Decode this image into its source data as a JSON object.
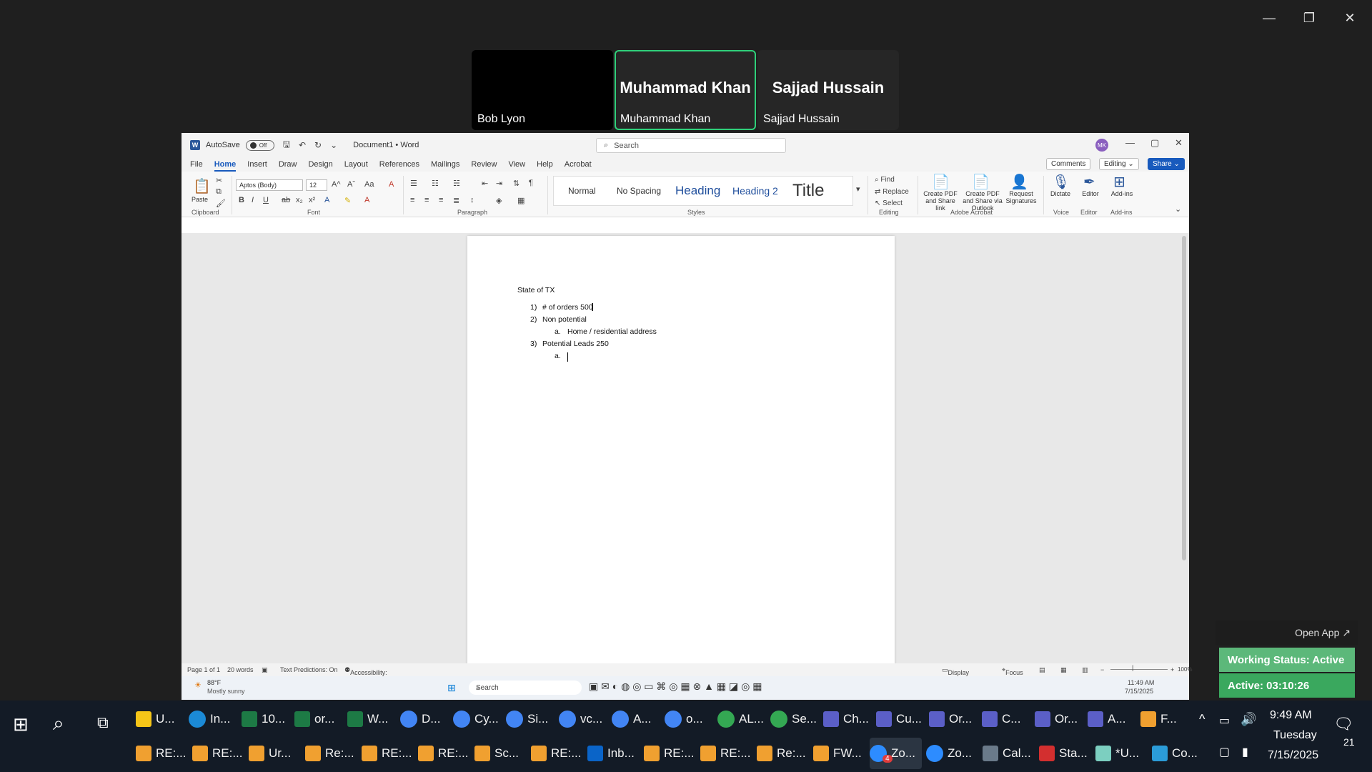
{
  "outer_window": {
    "minimize": "—",
    "restore": "❐",
    "close": "✕"
  },
  "participants": [
    {
      "name": "Bob Lyon",
      "display": "",
      "video_off_black": true
    },
    {
      "name": "Muhammad Khan",
      "display": "Muhammad Khan",
      "active_speaker": true
    },
    {
      "name": "Sajjad Hussain",
      "display": "Sajjad Hussain"
    }
  ],
  "word": {
    "autosave_label": "AutoSave",
    "autosave_state": "Off",
    "doc_title": "Document1 • Word",
    "search_placeholder": "Search",
    "avatar_initials": "MK",
    "menu": [
      "File",
      "Home",
      "Insert",
      "Draw",
      "Design",
      "Layout",
      "References",
      "Mailings",
      "Review",
      "View",
      "Help",
      "Acrobat"
    ],
    "menu_selected": "Home",
    "comments_label": "Comments",
    "editing_label": "Editing",
    "share_label": "Share",
    "font_name": "Aptos (Body)",
    "font_size": "12",
    "groups": {
      "clipboard": "Clipboard",
      "font": "Font",
      "paragraph": "Paragraph",
      "styles": "Styles",
      "editing": "Editing",
      "adobe": "Adobe Acrobat",
      "voice": "Voice",
      "editor": "Editor",
      "addins": "Add-ins"
    },
    "paste_label": "Paste",
    "styles": [
      "Normal",
      "No Spacing",
      "Heading",
      "Heading 2",
      "Title"
    ],
    "find_label": "Find",
    "replace_label": "Replace",
    "select_label": "Select",
    "create_pdf_link": "Create PDF and Share link",
    "create_pdf_outlook": "Create PDF and Share via Outlook",
    "request_signatures": "Request Signatures",
    "dictate_label": "Dictate",
    "editor_label": "Editor",
    "addins_label": "Add-ins",
    "document": {
      "heading": "State of TX",
      "items": [
        {
          "marker": "1)",
          "text": "# of orders 500"
        },
        {
          "marker": "2)",
          "text": "Non potential"
        },
        {
          "marker": "a.",
          "text": "Home / residential address"
        },
        {
          "marker": "3)",
          "text": "Potential Leads 250"
        },
        {
          "marker": "a.",
          "text": ""
        }
      ]
    },
    "status": {
      "page": "Page 1 of 1",
      "words": "20 words",
      "predictions": "Text Predictions: On",
      "accessibility": "Accessibility: Good to go",
      "display_settings": "Display Settings",
      "focus": "Focus",
      "zoom": "100%"
    }
  },
  "inner_taskbar": {
    "weather_temp": "88°F",
    "weather_desc": "Mostly sunny",
    "search": "Search",
    "time": "11:49 AM",
    "date": "7/15/2025"
  },
  "zoom_overlay": {
    "open_app": "Open App ↗",
    "working_status": "Working Status: Active",
    "active_timer": "Active: 03:10:26",
    "colors": {
      "working": "#5cb87a",
      "active": "#3aa85e"
    }
  },
  "taskbar": {
    "row1": [
      {
        "label": "U...",
        "color": "#f5c518",
        "shape": "sq"
      },
      {
        "label": "In...",
        "color": "#1b8ad6",
        "shape": "ico"
      },
      {
        "label": "10...",
        "color": "#1d7a45",
        "shape": "sq"
      },
      {
        "label": "or...",
        "color": "#1d7a45",
        "shape": "sq"
      },
      {
        "label": "W...",
        "color": "#1d7a45",
        "shape": "sq"
      },
      {
        "label": "D...",
        "color": "#4285f4",
        "shape": "ico"
      },
      {
        "label": "Cy...",
        "color": "#4285f4",
        "shape": "ico"
      },
      {
        "label": "Si...",
        "color": "#4285f4",
        "shape": "ico"
      },
      {
        "label": "vc...",
        "color": "#4285f4",
        "shape": "ico"
      },
      {
        "label": "A...",
        "color": "#4285f4",
        "shape": "ico"
      },
      {
        "label": "o...",
        "color": "#4285f4",
        "shape": "ico"
      },
      {
        "label": "AL...",
        "color": "#34a853",
        "shape": "ico"
      },
      {
        "label": "Se...",
        "color": "#34a853",
        "shape": "ico"
      },
      {
        "label": "Ch...",
        "color": "#5b5fc7",
        "shape": "sq"
      },
      {
        "label": "Cu...",
        "color": "#5b5fc7",
        "shape": "sq"
      },
      {
        "label": "Or...",
        "color": "#5b5fc7",
        "shape": "sq"
      },
      {
        "label": "C...",
        "color": "#5b5fc7",
        "shape": "sq"
      },
      {
        "label": "Or...",
        "color": "#5b5fc7",
        "shape": "sq"
      },
      {
        "label": "A...",
        "color": "#5b5fc7",
        "shape": "sq"
      },
      {
        "label": "F...",
        "color": "#f0a030",
        "shape": "sq"
      }
    ],
    "row2": [
      {
        "label": "RE:...",
        "color": "#f0a030",
        "shape": "sq"
      },
      {
        "label": "RE:...",
        "color": "#f0a030",
        "shape": "sq"
      },
      {
        "label": "Ur...",
        "color": "#f0a030",
        "shape": "sq"
      },
      {
        "label": "Re:...",
        "color": "#f0a030",
        "shape": "sq"
      },
      {
        "label": "RE:...",
        "color": "#f0a030",
        "shape": "sq"
      },
      {
        "label": "RE:...",
        "color": "#f0a030",
        "shape": "sq"
      },
      {
        "label": "Sc...",
        "color": "#f0a030",
        "shape": "sq"
      },
      {
        "label": "RE:...",
        "color": "#f0a030",
        "shape": "sq"
      },
      {
        "label": "Inb...",
        "color": "#0a64c8",
        "shape": "sq"
      },
      {
        "label": "RE:...",
        "color": "#f0a030",
        "shape": "sq"
      },
      {
        "label": "RE:...",
        "color": "#f0a030",
        "shape": "sq"
      },
      {
        "label": "Re:...",
        "color": "#f0a030",
        "shape": "sq"
      },
      {
        "label": "FW...",
        "color": "#f0a030",
        "shape": "sq"
      },
      {
        "label": "Zo...",
        "color": "#2d8cff",
        "shape": "ico",
        "badge": "4"
      },
      {
        "label": "Zo...",
        "color": "#2d8cff",
        "shape": "ico"
      },
      {
        "label": "Cal...",
        "color": "#6a7a8a",
        "shape": "sq"
      },
      {
        "label": "Sta...",
        "color": "#d32f2f",
        "shape": "sq"
      },
      {
        "label": "*U...",
        "color": "#7ccfc0",
        "shape": "sq"
      },
      {
        "label": "Co...",
        "color": "#2b9cd8",
        "shape": "sq"
      }
    ],
    "clock_time": "9:49 AM",
    "clock_day": "Tuesday",
    "clock_date": "7/15/2025",
    "notif_count": "21"
  }
}
